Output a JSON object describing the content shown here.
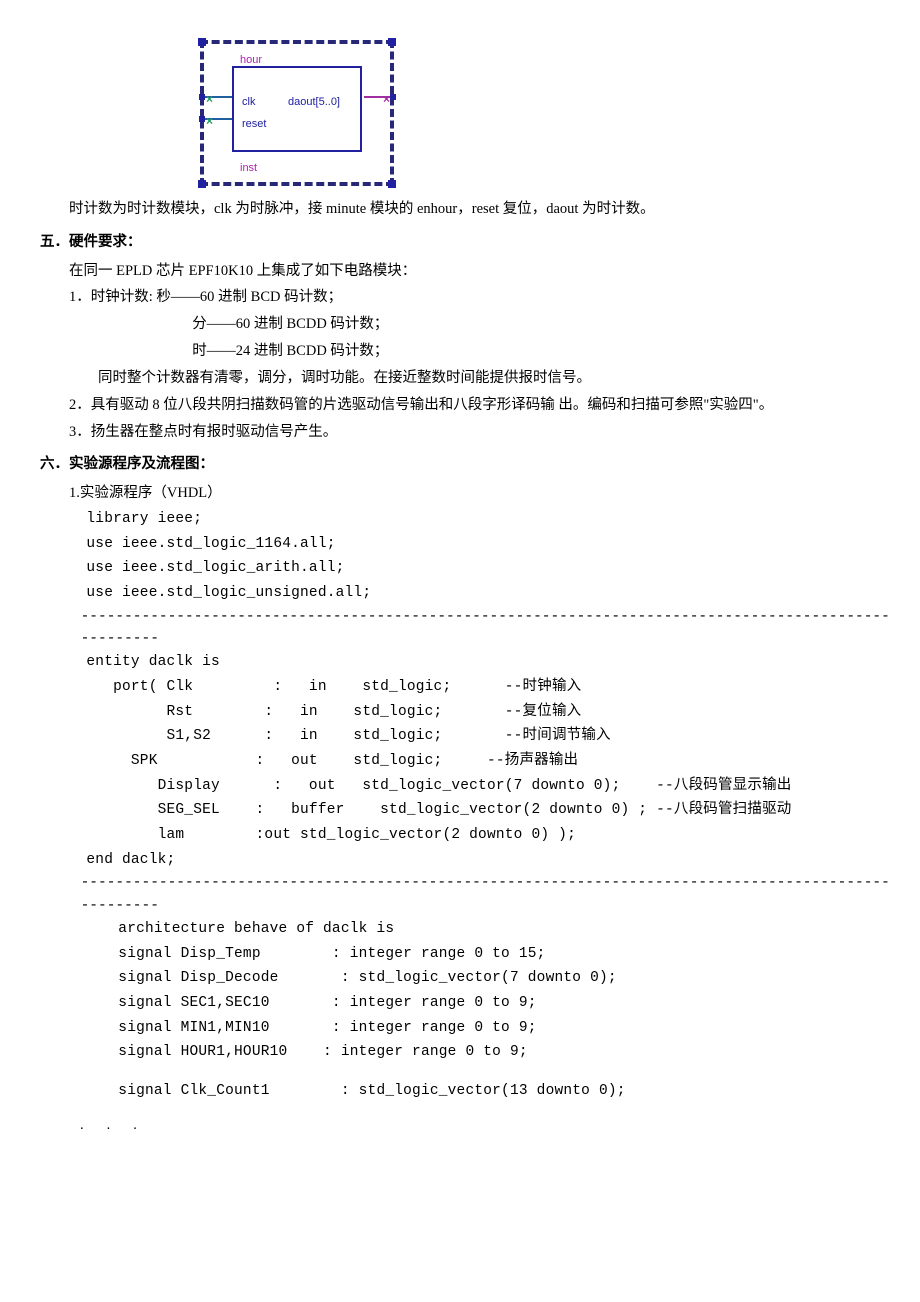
{
  "diagram": {
    "title": "hour",
    "port_clk": "clk",
    "port_daout": "daout[5..0]",
    "port_reset": "reset",
    "inst": "inst"
  },
  "p_desc": "时计数为时计数模块，clk 为时脉冲，接 minute 模块的 enhour，reset 复位，daout 为时计数。",
  "h5": "五．硬件要求：",
  "h5_intro": "在同一 EPLD 芯片 EPF10K10 上集成了如下电路模块：",
  "h5_1": "1．时钟计数:      秒——60 进制 BCD 码计数；",
  "h5_1b": "分——60 进制 BCDD 码计数；",
  "h5_1c": "时——24 进制 BCDD 码计数；",
  "h5_1d": "同时整个计数器有清零，调分，调时功能。在接近整数时间能提供报时信号。",
  "h5_2": "2．具有驱动 8 位八段共阴扫描数码管的片选驱动信号输出和八段字形译码输    出。编码和扫描可参照\"实验四\"。",
  "h5_3": "3．扬生器在整点时有报时驱动信号产生。",
  "h6": "六．实验源程序及流程图：",
  "h6_1": "1.实验源程序（VHDL）",
  "code_lib1": "library ieee;",
  "code_lib2": "use ieee.std_logic_1164.all;",
  "code_lib3": "use ieee.std_logic_arith.all;",
  "code_lib4": "use ieee.std_logic_unsigned.all;",
  "dash1a": "--------------------------------------------------------------------------------------------------",
  "dash1b": "---------",
  "code_ent1": "entity daclk is",
  "code_ent2": "   port( Clk         :   in    std_logic;      --时钟输入",
  "code_ent3": "         Rst        :   in    std_logic;       --复位输入",
  "code_ent4": "         S1,S2      :   in    std_logic;       --时间调节输入",
  "code_ent5": "     SPK           :   out    std_logic;     --扬声器输出",
  "code_ent6": "        Display      :   out   std_logic_vector(7 downto 0);    --八段码管显示输出",
  "code_ent7": "        SEG_SEL    :   buffer    std_logic_vector(2 downto 0) ; --八段码管扫描驱动",
  "code_ent8": "        lam        :out std_logic_vector(2 downto 0) );",
  "code_ent9": "end daclk;",
  "dash2a": "-----------------------------------------------------------------------------------------------",
  "dash2b": "---------",
  "code_arch1": "architecture behave of daclk is",
  "code_arch2": "signal Disp_Temp        : integer range 0 to 15;",
  "code_arch3": "signal Disp_Decode       : std_logic_vector(7 downto 0);",
  "code_arch4": "signal SEC1,SEC10       : integer range 0 to 9;",
  "code_arch5": "signal MIN1,MIN10       : integer range 0 to 9;",
  "code_arch6": "signal HOUR1,HOUR10    : integer range 0 to 9;",
  "code_arch7": "signal Clk_Count1        : std_logic_vector(13 downto 0);",
  "footer": "..."
}
